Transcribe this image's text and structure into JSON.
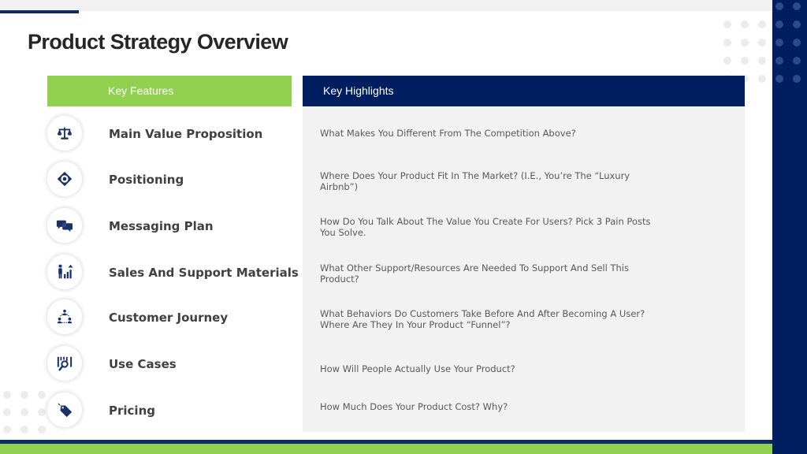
{
  "slide": {
    "title": "Product Strategy Overview",
    "colors": {
      "navy": "#001e60",
      "green": "#92d050",
      "panel": "#f2f2f2",
      "text_dark": "#404040",
      "text_body": "#595959"
    }
  },
  "headers": {
    "features": "Key Features",
    "highlights": "Key Highlights"
  },
  "rows": [
    {
      "icon": "scales-icon",
      "feature": "Main Value Proposition",
      "highlight": "What Makes You Different  From The Competition Above?"
    },
    {
      "icon": "target-icon",
      "feature": "Positioning",
      "highlight": "Where Does Your Product Fit In The Market? (I.E.,  You’re The “Luxury Airbnb”)"
    },
    {
      "icon": "chat-bubbles-icon",
      "feature": "Messaging Plan",
      "highlight": "How Do You Talk About The Value You Create For Users? Pick 3 Pain Posts You Solve."
    },
    {
      "icon": "growth-chart-person-icon",
      "feature": "Sales And Support Materials",
      "highlight": "What Other Support/Resources Are Needed To Support And Sell This Product?"
    },
    {
      "icon": "people-network-icon",
      "feature": "Customer Journey",
      "highlight": "What Behaviors Do Customers Take Before And After Becoming A User? Where Are They In Your Product “Funnel”?"
    },
    {
      "icon": "magnifier-chart-icon",
      "feature": "Use Cases",
      "highlight": "How Will  People Actually Use Your Product?"
    },
    {
      "icon": "price-tag-icon",
      "feature": "Pricing",
      "highlight": "How Much Does Your Product Cost? Why?"
    }
  ]
}
